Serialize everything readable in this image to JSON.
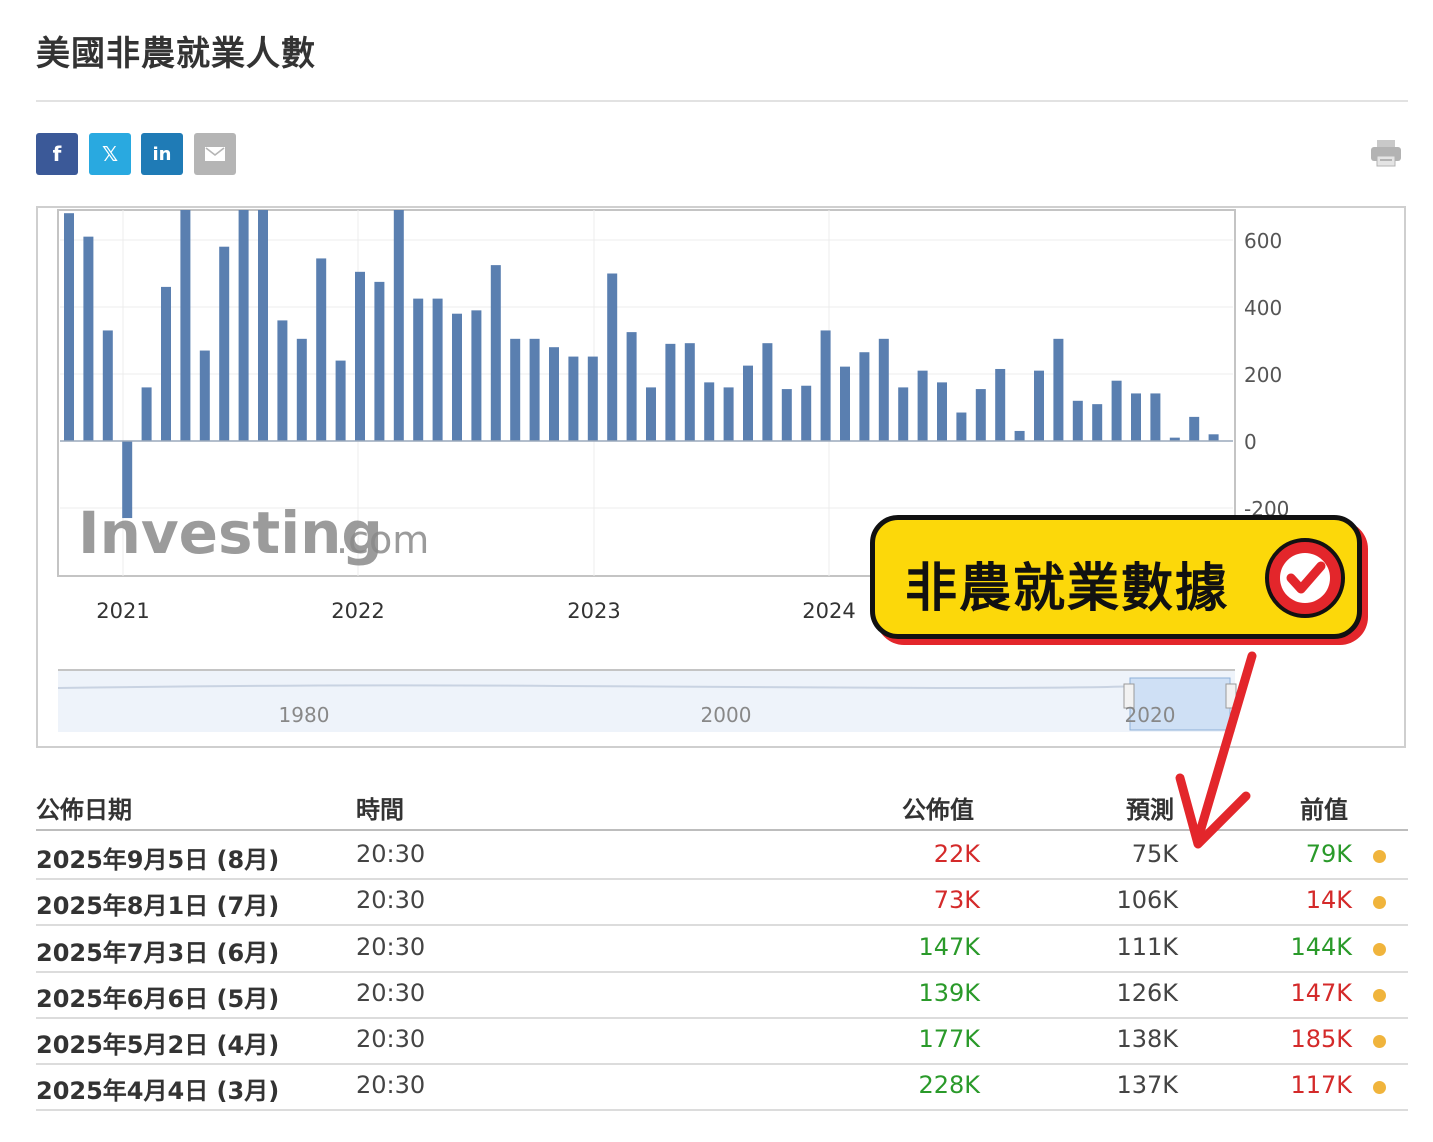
{
  "page": {
    "title": "美國非農就業人數"
  },
  "share": {
    "facebook_icon": "f",
    "twitter_icon": "𝕏",
    "linkedin_icon": "in",
    "email_icon": "envelope-icon",
    "print_icon": "printer-icon",
    "colors": {
      "facebook": "#3b5998",
      "twitter": "#29a9e0",
      "linkedin": "#1f7bb6",
      "email": "#b5b5b5"
    }
  },
  "chart_data": {
    "type": "bar",
    "title": "",
    "watermark_brand": "Investing",
    "watermark_suffix": ".com",
    "bar_color": "#5a7fb0",
    "y_ticks": [
      "600",
      "400",
      "200",
      "0",
      "-200"
    ],
    "ylim": [
      -400,
      700
    ],
    "x_ticks": [
      "2021",
      "2022",
      "2023",
      "2024"
    ],
    "values": [
      680,
      610,
      330,
      -230,
      160,
      460,
      700,
      270,
      580,
      700,
      700,
      360,
      305,
      545,
      240,
      505,
      475,
      700,
      425,
      425,
      380,
      390,
      525,
      305,
      305,
      280,
      252,
      252,
      500,
      325,
      160,
      290,
      292,
      175,
      160,
      225,
      292,
      155,
      165,
      330,
      222,
      265,
      305,
      160,
      210,
      175,
      85,
      155,
      215,
      30,
      210,
      305,
      120,
      110,
      180,
      142,
      142,
      10,
      72,
      20
    ],
    "navigator": {
      "labels": [
        "1980",
        "2000",
        "2020"
      ]
    }
  },
  "table": {
    "headers": {
      "date": "公佈日期",
      "time": "時間",
      "actual": "公佈值",
      "forecast": "預測",
      "previous": "前值"
    },
    "rows": [
      {
        "date": "2025年9月5日 (8月)",
        "time": "20:30",
        "actual": "22K",
        "actual_color": "red",
        "forecast": "75K",
        "previous": "79K",
        "previous_color": "green"
      },
      {
        "date": "2025年8月1日 (7月)",
        "time": "20:30",
        "actual": "73K",
        "actual_color": "red",
        "forecast": "106K",
        "previous": "14K",
        "previous_color": "red"
      },
      {
        "date": "2025年7月3日 (6月)",
        "time": "20:30",
        "actual": "147K",
        "actual_color": "green",
        "forecast": "111K",
        "previous": "144K",
        "previous_color": "green"
      },
      {
        "date": "2025年6月6日 (5月)",
        "time": "20:30",
        "actual": "139K",
        "actual_color": "green",
        "forecast": "126K",
        "previous": "147K",
        "previous_color": "red"
      },
      {
        "date": "2025年5月2日 (4月)",
        "time": "20:30",
        "actual": "177K",
        "actual_color": "green",
        "forecast": "138K",
        "previous": "185K",
        "previous_color": "red"
      },
      {
        "date": "2025年4月4日 (3月)",
        "time": "20:30",
        "actual": "228K",
        "actual_color": "green",
        "forecast": "137K",
        "previous": "117K",
        "previous_color": "red"
      }
    ]
  },
  "annotation": {
    "badge_text": "非農就業數據",
    "check_icon": "checkmark-icon",
    "arrow_color": "#e3262b"
  }
}
